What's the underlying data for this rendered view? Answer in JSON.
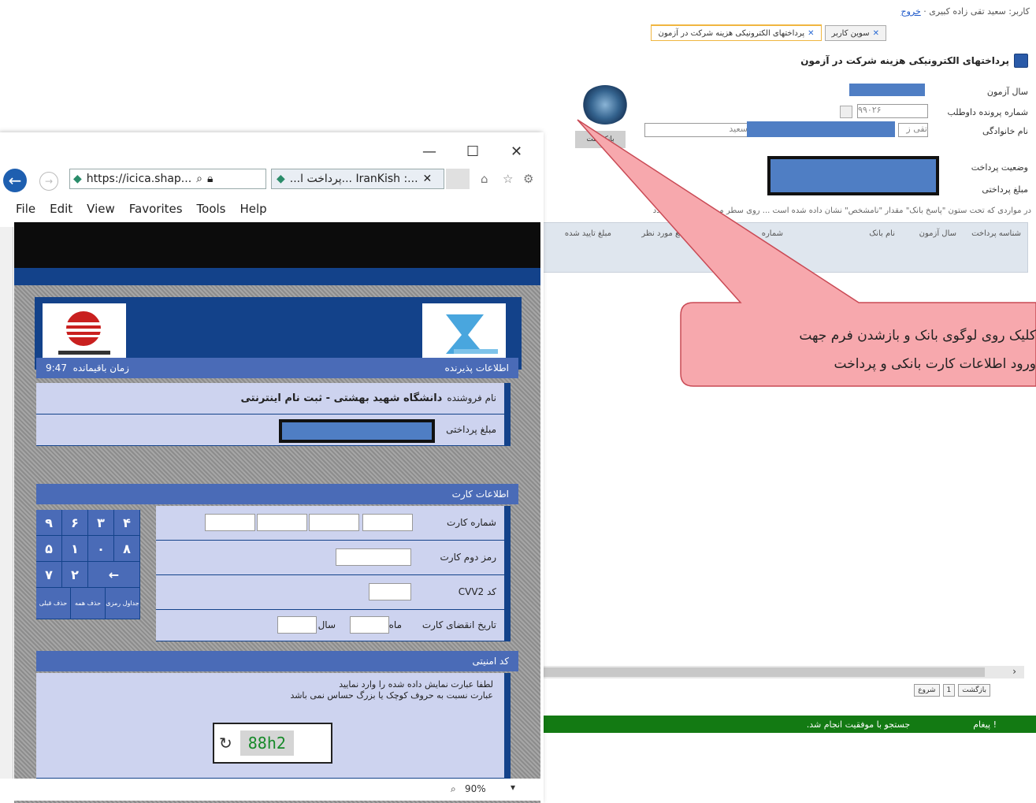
{
  "back_app": {
    "user_line": "کاربر: سعید تقی زاده کبیری",
    "logout": "خروج",
    "tabs": [
      {
        "label": "سوین کاربر"
      },
      {
        "label": "پرداختهای الکترونیکی هزینه شرکت در آزمون"
      }
    ],
    "page_title": "پرداختهای الکترونیکی هزینه شرکت در آزمون",
    "fields": {
      "exam_year": "سال آزمون",
      "file_number": "شماره پرونده داوطلب",
      "file_number_value": "۹۹۰۲۶",
      "family_name": "نام خانوادگی",
      "family_name_value": "تقی ز",
      "first_name_value": "سعید",
      "payment_status": "وضعیت پرداخت",
      "payment_amount": "مبلغ پرداختی"
    },
    "bank_logo_label": "بانک ملت",
    "notice": "در مواردی که تحت ستون \"پاسخ بانک\" مقدار \"نامشخص\" نشان داده شده است ... روی سطر مربوطه بررسی مجدد",
    "table_headers": [
      "شناسه پرداخت",
      "سال آزمون",
      "نام بانک",
      "شماره",
      "مبلغ مورد نظر",
      "مبلغ تایید شده"
    ],
    "nav": {
      "start": "شروع",
      "page": "1",
      "prev": "بازگشت"
    },
    "message_label": "! پیغام",
    "message_text": "جستجو با موفقیت انجام شد.",
    "callout_line1": "کلیک روی لوگوی بانک و بازشدن فرم جهت",
    "callout_line2": "ورود اطلاعات کارت بانکی و پرداخت"
  },
  "browser": {
    "address": "https://icica.shap...",
    "tab_title": "...پرداخت ا... IranKish :...",
    "menu": [
      "File",
      "Edit",
      "View",
      "Favorites",
      "Tools",
      "Help"
    ],
    "zoom": "90%"
  },
  "payment_form": {
    "merchant_section": "اطلاعات پذیرنده",
    "time_label": "زمان باقیمانده",
    "time_value": "9:47",
    "merchant_label": "نام فروشنده",
    "merchant_name": "دانشگاه شهید بهشتی - ثبت نام اینترنتی",
    "amount_label": "مبلغ پرداختی",
    "card_section": "اطلاعات کارت",
    "card_number_label": "شماره کارت",
    "pin2_label": "رمز دوم کارت",
    "cvv2_label": "کد CVV2",
    "expiry_label": "تاریخ انقضای کارت",
    "month_label": "ماه",
    "year_label": "سال",
    "keypad_rows": [
      [
        "۹",
        "۶",
        "۳",
        "۴"
      ],
      [
        "۵",
        "۱",
        "۰",
        "۸"
      ],
      [
        "۷",
        "۲",
        "←",
        ""
      ]
    ],
    "keypad_bottom": [
      "حذف قبلی",
      "حذف همه",
      "جداول رمزی"
    ],
    "security_section": "کد امنیتی",
    "security_text1": "لطفا عبارت نمایش داده شده را وارد نمایید",
    "security_text2": "عبارت نسبت به حروف کوچک یا بزرگ حساس نمی باشد",
    "captcha": "88h2"
  },
  "colors": {
    "form_blue": "#13428a",
    "section_blue": "#4a6bb7",
    "row_bg": "#cdd3ef",
    "green_bar": "#137a13",
    "callout_fill": "#f7a8ad"
  }
}
